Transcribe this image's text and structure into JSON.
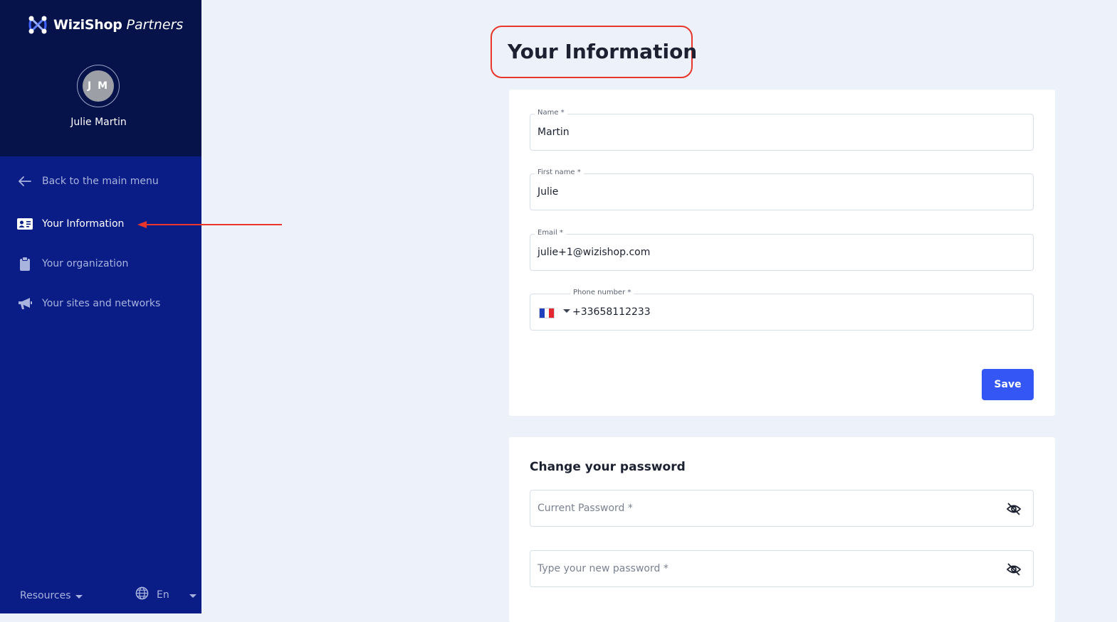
{
  "brand": {
    "name": "WiziShop",
    "suffix": "Partners"
  },
  "user": {
    "initials": "J M",
    "name": "Julie Martin"
  },
  "nav": {
    "back": "Back to the main menu",
    "items": [
      {
        "label": "Your Information",
        "icon": "id-card-icon",
        "active": true
      },
      {
        "label": "Your organization",
        "icon": "clipboard-icon",
        "active": false
      },
      {
        "label": "Your sites and networks",
        "icon": "megaphone-icon",
        "active": false
      }
    ]
  },
  "footer": {
    "resources": "Resources",
    "language": "En"
  },
  "page": {
    "title": "Your Information"
  },
  "form": {
    "name": {
      "label": "Name *",
      "value": "Martin"
    },
    "first_name": {
      "label": "First name *",
      "value": "Julie"
    },
    "email": {
      "label": "Email *",
      "value": "julie+1@wizishop.com"
    },
    "phone": {
      "label": "Phone number *",
      "value": "+33658112233",
      "country": "fr-flag-icon"
    },
    "save_label": "Save"
  },
  "password": {
    "title": "Change your password",
    "current_placeholder": "Current Password *",
    "new_placeholder": "Type your new password *"
  },
  "colors": {
    "sidebar": "#0a1d87",
    "sidebar_top": "#06124a",
    "accent": "#3356f5",
    "annotation": "#e9352a",
    "background": "#edf2fa"
  }
}
